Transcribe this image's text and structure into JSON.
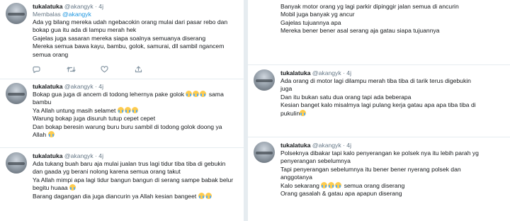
{
  "left": [
    {
      "name": "tukalatuka",
      "handle": "@akangyk",
      "sep": "·",
      "time": "4j",
      "reply_prefix": "Membalas",
      "reply_to": "@akangyk",
      "lines": [
        "Ada yg bilang mereka udah ngebacokin orang mulai dari pasar rebo dan",
        "bokap gua itu ada di lampu merah hek",
        "Gajelas juga sasaran mereka siapa soalnya semuanya diserang",
        "Mereka semua bawa kayu, bambu, golok, samurai, dll sambil ngancem",
        "semua orang"
      ]
    },
    {
      "name": "tukalatuka",
      "handle": "@akangyk",
      "sep": "·",
      "time": "4j",
      "lines": [
        "Bokap gua juga di ancem di todong lehernya pake golok",
        "bambu",
        "Ya Allah untung masih selamet",
        "Warung bokap juga disuruh tutup cepet cepet",
        "Dan bokap beresin warung buru buru sambil di todong golok doong ya",
        "Allah"
      ],
      "line_tails": [
        "sama",
        "",
        "",
        "",
        "",
        ""
      ]
    },
    {
      "name": "tukalatuka",
      "handle": "@akangyk",
      "sep": "·",
      "time": "4j",
      "lines": [
        "Ada tukang buah baru aja mulai jualan trus lagi tidur tiba tiba di gebukin",
        "dan gaada yg berani nolong karena semua orang takut",
        "Ya Allah mimpi apa lagi tidur bangun bangun di serang sampe babak belur",
        "begitu huaaa",
        "Barang dagangan dia juga diancurin ya Allah kesian bangeet"
      ]
    }
  ],
  "right": [
    {
      "lines": [
        "Banyak motor orang yg lagi parkir dipinggir jalan semua di ancurin",
        "Mobil juga banyak yg ancur",
        "Gajelas tujuannya apa",
        "Mereka bener bener asal serang aja gatau siapa tujuannya"
      ]
    },
    {
      "name": "tukalatuka",
      "handle": "@akangyk",
      "sep": "·",
      "time": "4j",
      "lines": [
        "Ada orang di motor lagi dilampu merah tiba tiba di tarik terus digebukin",
        "juga",
        "Dan itu bukan satu dua orang tapi ada beberapa",
        "Kesian banget kalo misalmya lagi pulang kerja gatau apa apa tiba tiba di",
        "pukulin"
      ]
    },
    {
      "name": "tukalatuka",
      "handle": "@akangyk",
      "sep": "·",
      "time": "4j",
      "lines": [
        "Polseknya dibakar tapi kalo penyerangan ke polsek nya itu lebih parah yg",
        "penyerangan sebelumnya",
        "Tapi penyerangan sebelumnya itu bener bener nyerang polsek dan",
        "anggotanya",
        "Kalo sekarang",
        "Orang gasalah & gatau apa apapun diserang"
      ],
      "line_tails": [
        "",
        "",
        "",
        "",
        "semua orang diserang",
        ""
      ]
    }
  ]
}
